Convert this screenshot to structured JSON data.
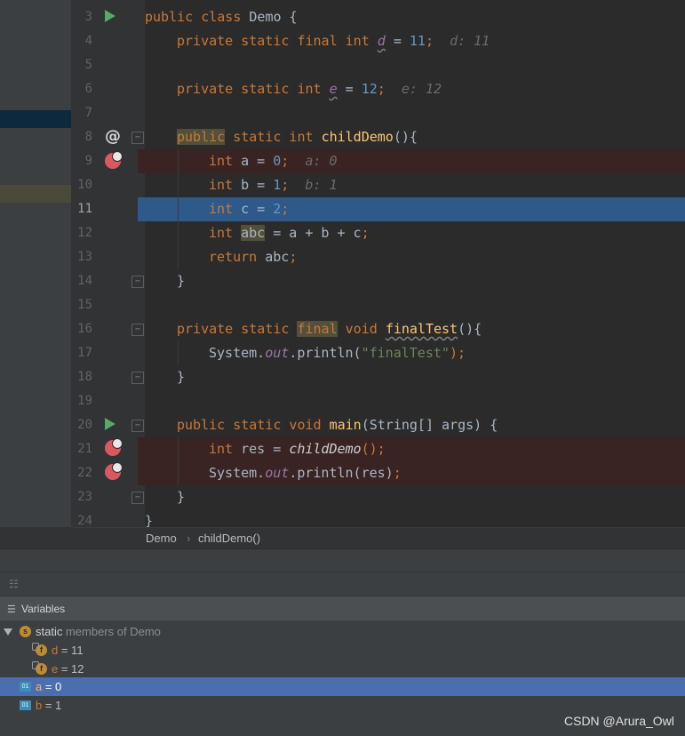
{
  "editor": {
    "line_numbers": [
      "3",
      "4",
      "5",
      "6",
      "7",
      "8",
      "9",
      "10",
      "11",
      "12",
      "13",
      "14",
      "15",
      "16",
      "17",
      "18",
      "19",
      "20",
      "21",
      "22",
      "23",
      "24"
    ],
    "lines": {
      "l3": {
        "kw": "public class ",
        "name": "Demo {"
      },
      "l4": {
        "kw": "private static final int ",
        "var": "d",
        "rest": " = ",
        "num": "11",
        "semi": ";",
        "inline": "d: 11"
      },
      "l6": {
        "kw": "private static int ",
        "var": "e",
        "rest": " = ",
        "num": "12",
        "semi": ";",
        "inline": "e: 12"
      },
      "l8": {
        "kw1": "public",
        "kw2": " static int ",
        "method": "childDemo",
        "rest": "(){"
      },
      "l9": {
        "kw": "int ",
        "rest": "a = ",
        "num": "0",
        "semi": ";",
        "inline": "a: 0"
      },
      "l10": {
        "kw": "int ",
        "rest": "b = ",
        "num": "1",
        "semi": ";",
        "inline": "b: 1"
      },
      "l11": {
        "kw": "int ",
        "rest": "c = ",
        "num": "2",
        "semi": ";"
      },
      "l12": {
        "kw": "int ",
        "var": "abc",
        "rest": " = a + b + c",
        "semi": ";"
      },
      "l13": {
        "kw": "return ",
        "rest": "abc",
        "semi": ";"
      },
      "l14": {
        "text": "}"
      },
      "l16": {
        "kw": "private static ",
        "kw_hl": "final",
        "kw2": " void ",
        "method": "finalTest",
        "rest": "(){"
      },
      "l17": {
        "cls": "System.",
        "fld": "out",
        "call": ".println(",
        "str": "\"finalTest\"",
        "end": ");"
      },
      "l18": {
        "text": "}"
      },
      "l20": {
        "kw": "public static void ",
        "method": "main",
        "rest": "(String[] args) {"
      },
      "l21": {
        "kw": "int ",
        "rest": "res = ",
        "call": "childDemo",
        "end": "();"
      },
      "l22": {
        "cls": "System.",
        "fld": "out",
        "call": ".println(res)",
        "end": ";"
      },
      "l23": {
        "text": "}"
      },
      "l24": {
        "text": "}"
      }
    }
  },
  "breadcrumb": {
    "class": "Demo",
    "sep": "›",
    "method": "childDemo()"
  },
  "debugger": {
    "variables_title": "Variables",
    "static_group": {
      "badge": "s",
      "label_kw": "static",
      "label_rest": " members of Demo"
    },
    "items": [
      {
        "badge": "f",
        "name": "d",
        "value": " = 11"
      },
      {
        "badge": "f",
        "name": "e",
        "value": " = 12"
      },
      {
        "badge": "01",
        "name": "a",
        "value": " = 0",
        "selected": true
      },
      {
        "badge": "01",
        "name": "b",
        "value": " = 1"
      }
    ]
  },
  "watermark": "CSDN @Arura_Owl",
  "colors": {
    "breakpoint": "#db5860",
    "execution_line": "#2d5a8a",
    "keyword": "#cc7832",
    "number": "#6897bb"
  }
}
